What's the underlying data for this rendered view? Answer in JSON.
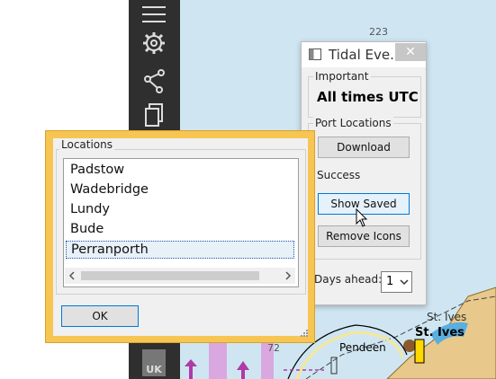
{
  "chart": {
    "depth_labels": [
      "223",
      "72"
    ],
    "place_labels": [
      "St. Ives",
      "St. Ives",
      "Pendeen"
    ]
  },
  "toolbar": {
    "items": [
      {
        "icon": "menu-icon"
      },
      {
        "icon": "gear-icon"
      },
      {
        "icon": "route-icon"
      },
      {
        "icon": "documents-icon"
      },
      {
        "icon": "uk-chart-icon"
      }
    ]
  },
  "tidal_window": {
    "title": "Tidal Eve...",
    "close": "✕",
    "important_label": "Important",
    "important_text": "All times UTC",
    "ports_label": "Port Locations",
    "download_button": "Download",
    "status": "Success",
    "show_saved_button": "Show Saved",
    "remove_icons_button": "Remove Icons",
    "days_ahead_label": "Days ahead:",
    "days_ahead_value": "1"
  },
  "locations_dialog": {
    "group_label": "Locations",
    "items": [
      "Padstow",
      "Wadebridge",
      "Lundy",
      "Bude",
      "Perranporth"
    ],
    "selected_index": 4,
    "ok_button": "OK"
  },
  "colors": {
    "sea": "#cfe6f2",
    "deep_sea": "#5aaee0",
    "land": "#e8c98b",
    "toolbar": "#2f2f2f",
    "dialog_frame": "#f7c552",
    "selection": "#1e5aa8"
  }
}
